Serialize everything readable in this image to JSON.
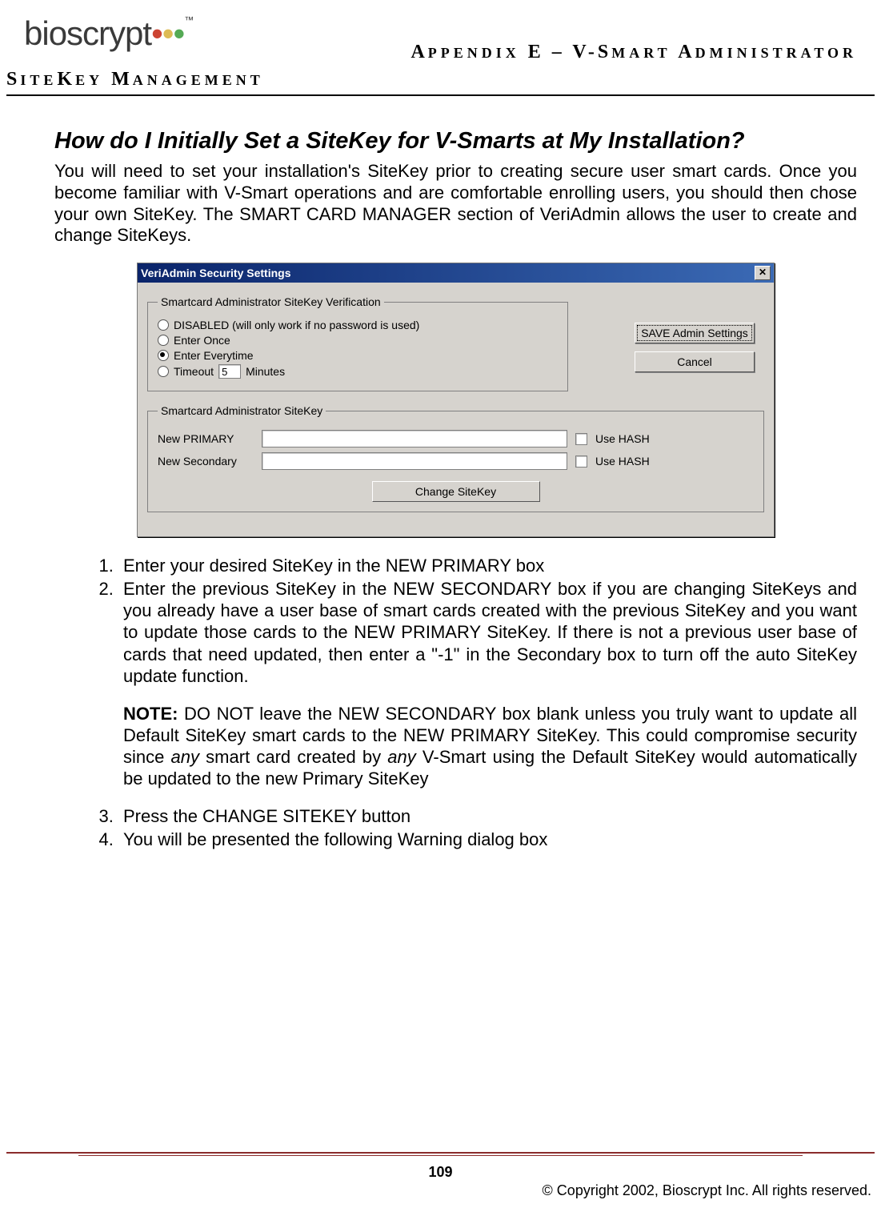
{
  "logo_text": "bioscrypt",
  "logo_tm": "™",
  "header": {
    "line1_caps": "A",
    "line1_sc1": "PPENDIX",
    "line1_mid": " E – V-S",
    "line1_sc2": "MART",
    "line1_mid2": " A",
    "line1_sc3": "DMINISTRATOR",
    "line2_caps1": "S",
    "line2_sc1": "ITE",
    "line2_caps2": "K",
    "line2_sc2": "EY",
    "line2_mid": " M",
    "line2_sc3": "ANAGEMENT"
  },
  "section_heading": "How do I Initially Set a SiteKey for V-Smarts at My Installation?",
  "intro_para": "You will need to set your installation's SiteKey prior to creating secure user smart cards. Once you become familiar with V-Smart operations and are comfortable enrolling users, you should then chose your own SiteKey.  The SMART CARD MANAGER section of VeriAdmin allows the user to create and change SiteKeys.",
  "dialog": {
    "title": "VeriAdmin Security Settings",
    "close_glyph": "✕",
    "group1_legend": "Smartcard Administrator SiteKey Verification",
    "radios": {
      "r1": "DISABLED (will only work if no password is used)",
      "r2": "Enter Once",
      "r3": "Enter Everytime",
      "r4": "Timeout",
      "timeout_value": "5",
      "timeout_unit": "Minutes"
    },
    "save_btn": "SAVE Admin Settings",
    "cancel_btn": "Cancel",
    "group2_legend": "Smartcard Administrator SiteKey",
    "primary_label": "New PRIMARY",
    "secondary_label": "New Secondary",
    "use_hash": "Use HASH",
    "change_btn": "Change SiteKey"
  },
  "steps": {
    "s1": "Enter your desired SiteKey in the NEW PRIMARY box",
    "s2": "Enter the previous SiteKey in the NEW SECONDARY box if you are changing SiteKeys and you already have a user base of smart cards created with the previous SiteKey and you want to update those cards to the NEW PRIMARY SiteKey.  If there is not a previous user base of cards that need updated, then enter a \"-1\" in the Secondary box to turn off the auto SiteKey update function.",
    "note_label": "NOTE:",
    "note_text_1": " DO NOT leave the NEW SECONDARY box blank unless you truly want to update all Default SiteKey smart cards to the NEW PRIMARY SiteKey.  This could compromise security since ",
    "note_any1": "any",
    "note_text_2": " smart card created by ",
    "note_any2": "any",
    "note_text_3": " V-Smart using the Default SiteKey would automatically be updated to the new Primary SiteKey",
    "s3": "Press the CHANGE SITEKEY button",
    "s4": "You will be presented the following Warning dialog box"
  },
  "page_number": "109",
  "copyright": "© Copyright 2002, Bioscrypt Inc.  All rights reserved."
}
